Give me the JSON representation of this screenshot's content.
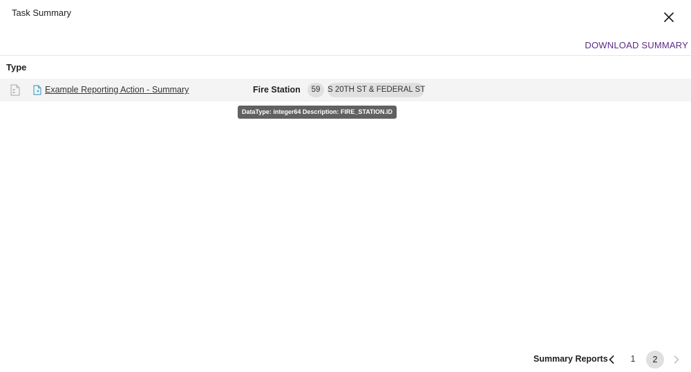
{
  "dialog": {
    "title": "Task Summary",
    "close_icon": "close-icon"
  },
  "toolbar": {
    "download_label": "DOWNLOAD SUMMARY",
    "accent_color": "#5b2a86"
  },
  "table": {
    "column_header": "Type",
    "rows": [
      {
        "type_icon": "document-outline-icon",
        "link_icon": "file-link-icon",
        "link_label": "Example Reporting Action - Summary",
        "field_label": "Fire Station",
        "chip_id": "59",
        "chip_name": "S 20TH ST & FEDERAL ST"
      }
    ]
  },
  "tooltip": {
    "text": "DataType: integer64 Description: FIRE_STATION.ID"
  },
  "pagination": {
    "label": "Summary Reports",
    "prev_icon": "chevron-left-icon",
    "next_icon": "chevron-right-icon",
    "pages": [
      "1",
      "2"
    ],
    "current_page": "2"
  }
}
